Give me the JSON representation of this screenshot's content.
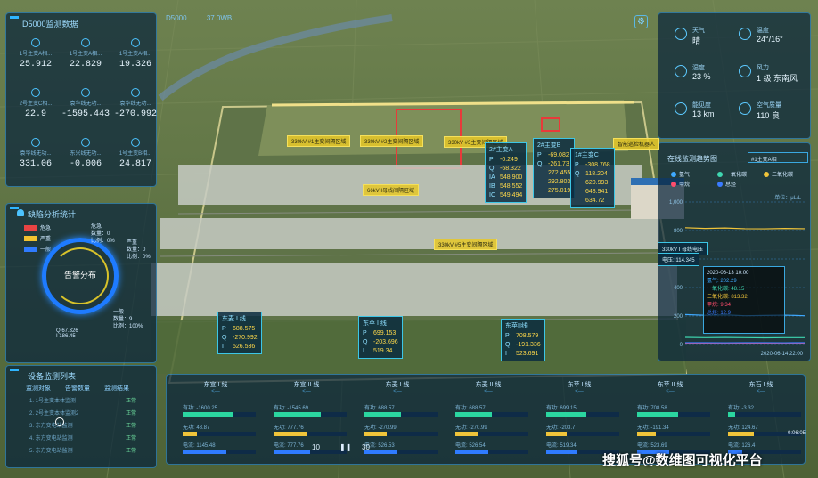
{
  "topbar": {
    "device": "D5000",
    "version": "37.0WB"
  },
  "d5000": {
    "title": "D5000监测数据",
    "metrics": [
      {
        "label": "1号主变A相...",
        "value": "25.912",
        "icon": "thermometer-icon"
      },
      {
        "label": "1号主变A相...",
        "value": "22.829",
        "icon": "thermometer-icon"
      },
      {
        "label": "1号主变A相...",
        "value": "19.326",
        "icon": "thermometer-icon"
      },
      {
        "label": "2号主变C相...",
        "value": "22.9",
        "icon": "gauge-icon"
      },
      {
        "label": "袁华线无功...",
        "value": "-1595.443",
        "icon": "gauge-icon"
      },
      {
        "label": "袁华线无功...",
        "value": "-270.992",
        "icon": "gauge-icon"
      },
      {
        "label": "袁华线无功...",
        "value": "331.06",
        "icon": "gauge-icon"
      },
      {
        "label": "东兴线无功...",
        "value": "-0.006",
        "icon": "gauge-icon"
      },
      {
        "label": "1号主变B相...",
        "value": "24.817",
        "icon": "thermometer-icon"
      }
    ]
  },
  "alarm": {
    "title": "缺陷分析统计",
    "legend": [
      {
        "label": "危急",
        "color": "#e84343"
      },
      {
        "label": "严重",
        "color": "#f2c230"
      },
      {
        "label": "一般",
        "color": "#2f7bff"
      }
    ],
    "gauge_label": "告警分布",
    "stats": [
      {
        "name": "危急",
        "count_label": "数量：0",
        "ratio_label": "比例：0%"
      },
      {
        "name": "严重",
        "count_label": "数量：0",
        "ratio_label": "比例：0%"
      },
      {
        "name": "一般",
        "count_label": "数量：9",
        "ratio_label": "比例：100%"
      }
    ],
    "extra_values": {
      "q": "67.326",
      "i": "186.45"
    }
  },
  "stations": {
    "title": "设备监测列表",
    "headers": [
      "监测对象",
      "告警数量",
      "监测结果"
    ],
    "rows": [
      {
        "name": "1. 1号主变本体监测",
        "result": "正常"
      },
      {
        "name": "2. 2号主变本体监测2",
        "result": "正常"
      },
      {
        "name": "3. 东方变电站监测",
        "result": "正常"
      },
      {
        "name": "4. 东方变电站监测",
        "result": "正常"
      },
      {
        "name": "5. 东方变电站监测",
        "result": "正常"
      }
    ]
  },
  "weather": {
    "items": [
      {
        "label": "天气",
        "value": "晴",
        "icon": "cloud-icon"
      },
      {
        "label": "温度",
        "value": "24°/16°",
        "icon": "thermometer-icon"
      },
      {
        "label": "湿度",
        "value": "23 %",
        "icon": "droplet-icon"
      },
      {
        "label": "风力",
        "value": "1 级 东南风",
        "icon": "wind-icon"
      },
      {
        "label": "能见度",
        "value": "13 km",
        "icon": "eye-icon"
      },
      {
        "label": "空气质量",
        "value": "110 良",
        "icon": "leaf-icon"
      }
    ]
  },
  "chart": {
    "title": "在线监测趋势图",
    "selector": "#1主变A相",
    "legend": [
      {
        "name": "氢气",
        "color": "#3fa9ff"
      },
      {
        "name": "一氧化碳",
        "color": "#3fd6b0"
      },
      {
        "name": "二氧化碳",
        "color": "#f0c43a"
      },
      {
        "name": "甲烷",
        "color": "#ff4d6d"
      },
      {
        "name": "总烃",
        "color": "#3a7bff"
      }
    ],
    "unit": "单位：μL/L",
    "tooltip": {
      "date": "2020-06-13 10:00",
      "rows": [
        "氢气: 202.29",
        "一氧化碳: 48.15",
        "二氧化碳: 813.32",
        "甲烷: 9.34",
        "总烃: 12.9"
      ]
    },
    "x_end_label": "2020-06-14 22:00"
  },
  "chart_data": {
    "type": "line",
    "ylim": [
      0,
      1000
    ],
    "y_ticks": [
      "1,000",
      "800",
      "600",
      "400",
      "200",
      "0"
    ],
    "x_end_label": "2020-06-14 22:00",
    "series": [
      {
        "name": "氢气",
        "values": [
          210,
          205,
          208,
          202,
          204,
          206,
          202
        ]
      },
      {
        "name": "一氧化碳",
        "values": [
          50,
          48,
          49,
          48,
          47,
          48,
          48
        ]
      },
      {
        "name": "二氧化碳",
        "values": [
          820,
          815,
          818,
          813,
          812,
          815,
          813
        ]
      },
      {
        "name": "甲烷",
        "values": [
          10,
          9,
          9,
          9,
          10,
          9,
          9
        ]
      },
      {
        "name": "总烃",
        "values": [
          13,
          13,
          12,
          13,
          13,
          12,
          13
        ]
      }
    ]
  },
  "scene_labels": {
    "yellow": [
      "330kV #1主变间隔区域",
      "330kV #2主变间隔区域",
      "330kV #3主变间隔区域",
      "66kV I母线间隔区域",
      "330kV #5主变间隔区域",
      "智能巡检机器人"
    ],
    "transformers": [
      {
        "title": "2#主变A",
        "rows": [
          [
            "P",
            "-0.249"
          ],
          [
            "Q",
            "-68.322"
          ],
          [
            "IA",
            "548.900"
          ],
          [
            "IB",
            "548.552"
          ],
          [
            "IC",
            "549.494"
          ]
        ]
      },
      {
        "title": "2#主变B",
        "rows": [
          [
            "P",
            "-69.082"
          ],
          [
            "Q",
            "-261.73"
          ],
          [
            "",
            "272.455"
          ],
          [
            "",
            "292.803"
          ],
          [
            "",
            "275.019"
          ]
        ]
      },
      {
        "title": "1#主变C",
        "rows": [
          [
            "P",
            "-308.768"
          ],
          [
            "Q",
            "118.204"
          ],
          [
            "",
            "620.993"
          ],
          [
            "",
            "648.941"
          ],
          [
            "",
            "634.72"
          ]
        ]
      }
    ],
    "feeders": [
      {
        "title": "东麦 I 线",
        "rows": [
          [
            "P",
            "688.575"
          ],
          [
            "Q",
            "-270.992"
          ],
          [
            "I",
            "526.536"
          ]
        ]
      },
      {
        "title": "东苹 I 线",
        "rows": [
          [
            "P",
            "699.153"
          ],
          [
            "Q",
            "-203.696"
          ],
          [
            "I",
            "519.34"
          ]
        ]
      },
      {
        "title": "东苹II线",
        "rows": [
          [
            "P",
            "708.579"
          ],
          [
            "Q",
            "-191.336"
          ],
          [
            "I",
            "523.691"
          ]
        ]
      }
    ],
    "side_tags": [
      "330kV I 母线电压",
      "电压: 114.345"
    ]
  },
  "lines": [
    {
      "name": "东宣 I 线",
      "p": "有功: -1600.25",
      "q": "无功: 48.87",
      "i": "电流: 1145.48",
      "pv": 0.7,
      "qv": 0.2,
      "iv": 0.6
    },
    {
      "name": "东宣 II 线",
      "p": "有功: -1545.69",
      "q": "无功: 777.76",
      "i": "电流: 777.76",
      "pv": 0.65,
      "qv": 0.45,
      "iv": 0.5
    },
    {
      "name": "东麦 I 线",
      "p": "有功: 688.57",
      "q": "无功: -270.99",
      "i": "电流: 526.53",
      "pv": 0.5,
      "qv": 0.3,
      "iv": 0.45
    },
    {
      "name": "东麦 II 线",
      "p": "有功: 688.57",
      "q": "无功: -270.99",
      "i": "电流: 526.54",
      "pv": 0.5,
      "qv": 0.3,
      "iv": 0.45
    },
    {
      "name": "东苹 I 线",
      "p": "有功: 699.15",
      "q": "无功: -203.7",
      "i": "电流: 519.34",
      "pv": 0.55,
      "qv": 0.28,
      "iv": 0.42
    },
    {
      "name": "东苹 II 线",
      "p": "有功: 708.58",
      "q": "无功: -191.34",
      "i": "电流: 523.69",
      "pv": 0.56,
      "qv": 0.26,
      "iv": 0.44
    },
    {
      "name": "东石 I 线",
      "p": "有功: -3.32",
      "q": "无功: 124.67",
      "i": "电流: 126.4",
      "pv": 0.1,
      "qv": 0.35,
      "iv": 0.2
    }
  ],
  "player": {
    "time": "0:06:05",
    "back": "10",
    "fwd": "30"
  },
  "watermark": "搜狐号@数维图可视化平台"
}
